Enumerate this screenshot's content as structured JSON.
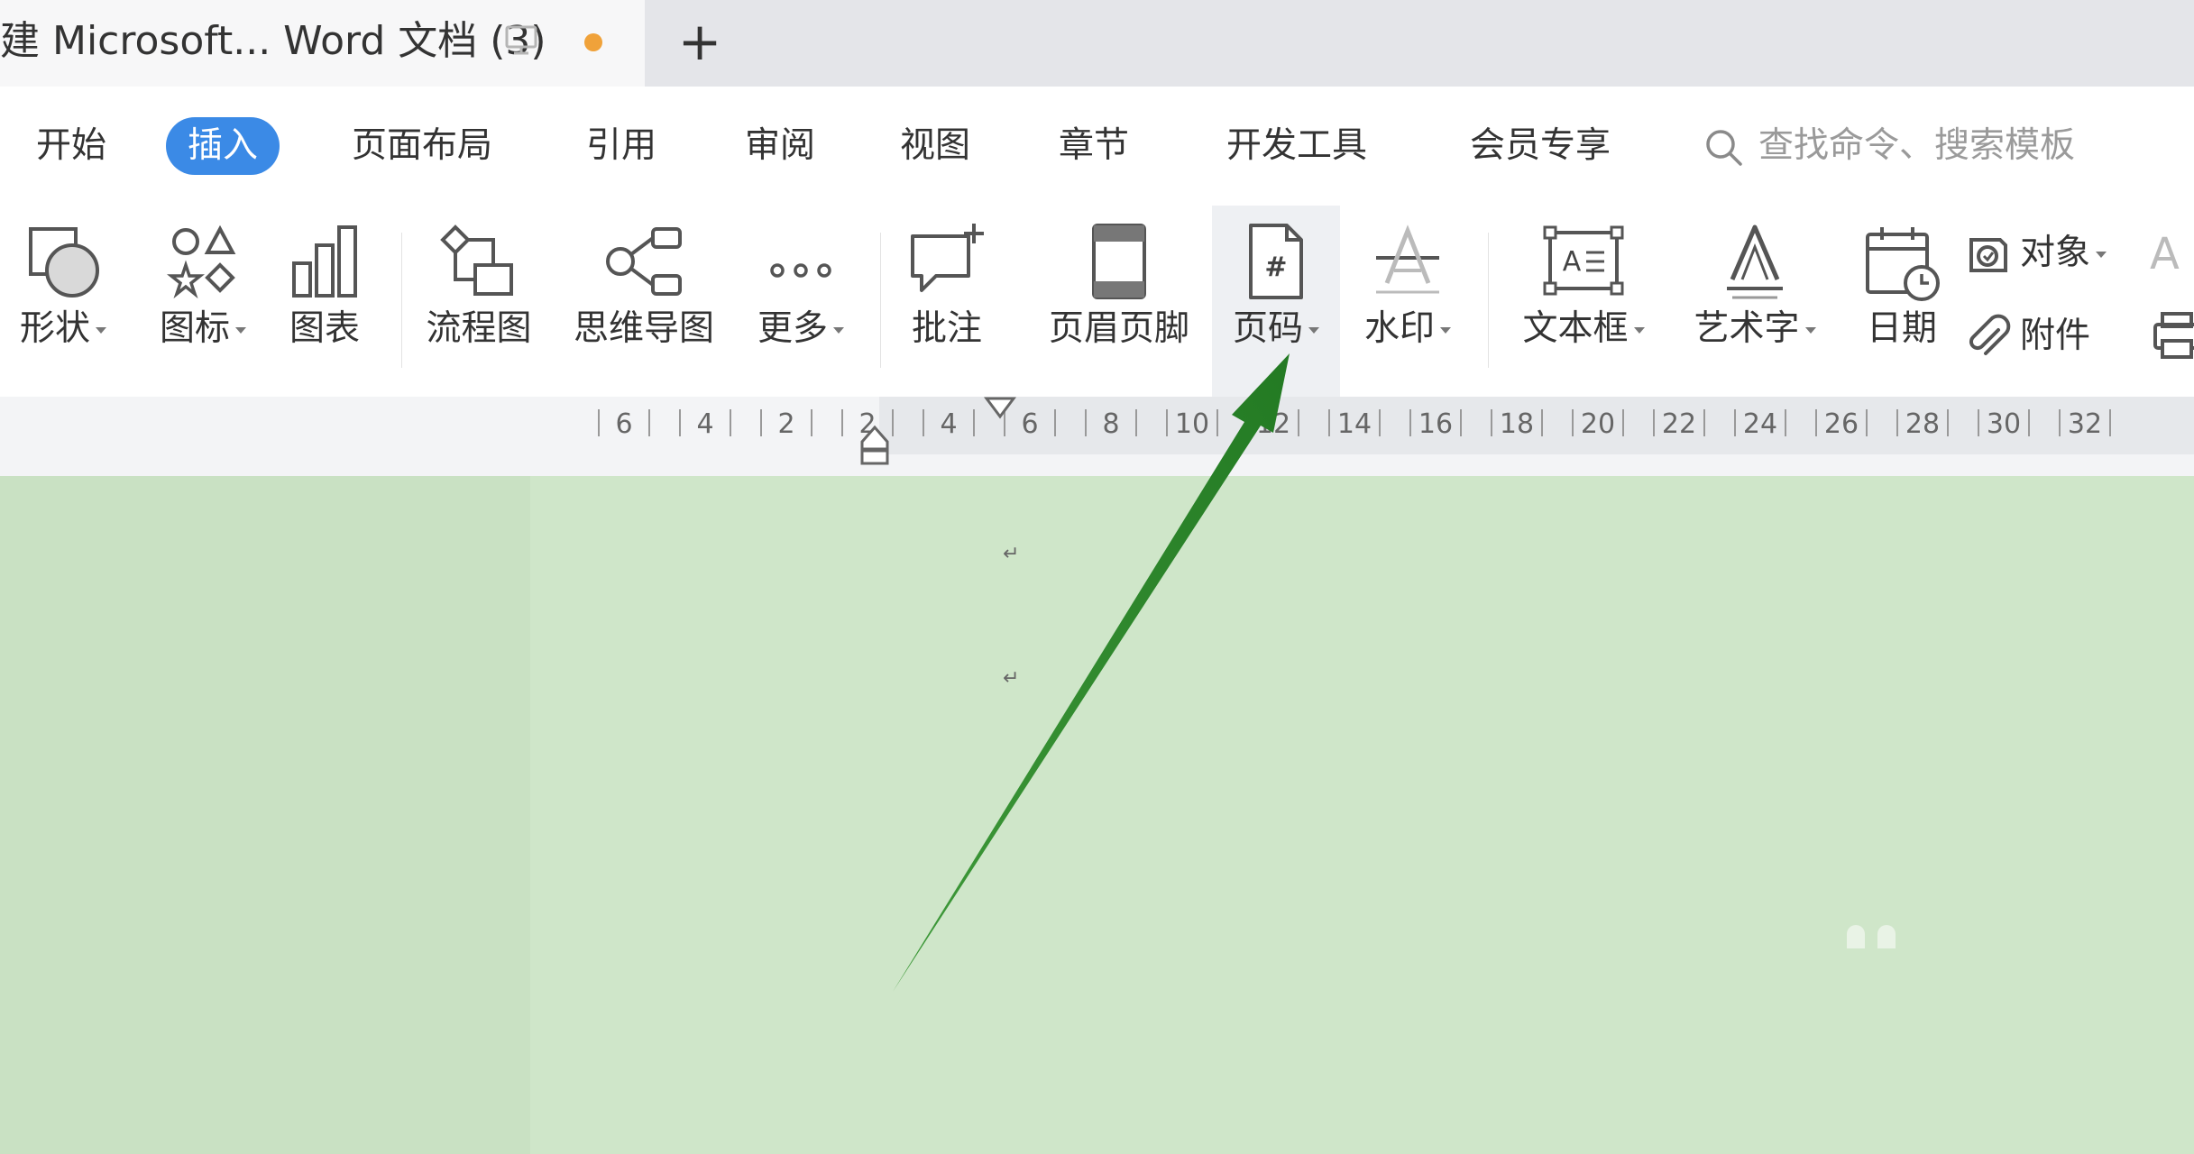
{
  "titlebar": {
    "doc_tab_title": "建 Microsoft... Word 文档 (3)",
    "new_tab_symbol": "+"
  },
  "menu": {
    "tabs": [
      "开始",
      "插入",
      "页面布局",
      "引用",
      "审阅",
      "视图",
      "章节",
      "开发工具",
      "会员专享"
    ],
    "active_tab": "插入",
    "search_placeholder": "查找命令、搜索模板"
  },
  "ribbon": {
    "tools": [
      {
        "label": "形状",
        "icon": "shape-icon",
        "dropdown": true
      },
      {
        "label": "图标",
        "icon": "icon-library-icon",
        "dropdown": true
      },
      {
        "label": "图表",
        "icon": "bar-chart-icon",
        "dropdown": false
      },
      {
        "label": "流程图",
        "icon": "flowchart-icon",
        "dropdown": false
      },
      {
        "label": "思维导图",
        "icon": "mindmap-icon",
        "dropdown": false
      },
      {
        "label": "更多",
        "icon": "more-icon",
        "dropdown": true
      },
      {
        "label": "批注",
        "icon": "comment-icon",
        "dropdown": false
      },
      {
        "label": "页眉页脚",
        "icon": "header-footer-icon",
        "dropdown": false
      },
      {
        "label": "页码",
        "icon": "page-number-icon",
        "dropdown": true
      },
      {
        "label": "水印",
        "icon": "watermark-icon",
        "dropdown": true
      },
      {
        "label": "文本框",
        "icon": "textbox-icon",
        "dropdown": true
      },
      {
        "label": "艺术字",
        "icon": "wordart-icon",
        "dropdown": true
      },
      {
        "label": "日期",
        "icon": "date-icon",
        "dropdown": false
      }
    ],
    "small_tools": [
      {
        "label": "对象",
        "icon": "object-icon",
        "dropdown": true
      },
      {
        "label": "附件",
        "icon": "attachment-icon",
        "dropdown": false
      }
    ]
  },
  "ruler": {
    "labels": [
      "6",
      "4",
      "2",
      "2",
      "4",
      "6",
      "8",
      "10",
      "12",
      "14",
      "16",
      "18",
      "20",
      "22",
      "24",
      "26",
      "28",
      "30",
      "32"
    ]
  },
  "document": {
    "paragraph_mark": "↵"
  },
  "annotation": {
    "arrow_color": "#2e8b2e",
    "points_to": "页码"
  },
  "colors": {
    "accent": "#3b8ae6",
    "page_background": "#cfe6c9",
    "modified_dot": "#f0a23a"
  }
}
